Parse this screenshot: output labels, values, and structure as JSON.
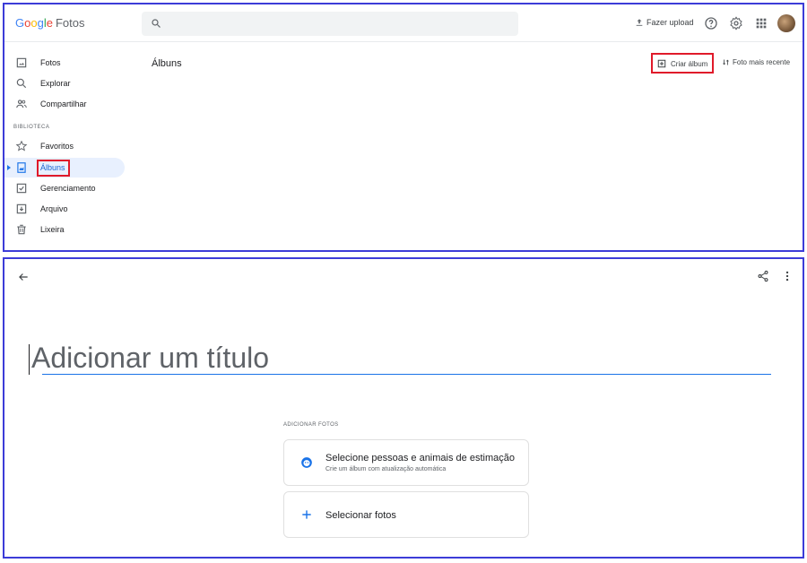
{
  "header": {
    "logo_letters": [
      "G",
      "o",
      "o",
      "g",
      "l",
      "e"
    ],
    "logo_product": "Fotos",
    "search_placeholder": "",
    "upload_label": "Fazer upload"
  },
  "sidebar": {
    "items": [
      {
        "label": "Fotos",
        "icon": "photo-icon"
      },
      {
        "label": "Explorar",
        "icon": "search-icon"
      },
      {
        "label": "Compartilhar",
        "icon": "people-icon"
      }
    ],
    "library_label": "BIBLIOTECA",
    "library_items": [
      {
        "label": "Favoritos",
        "icon": "star-icon"
      },
      {
        "label": "Álbuns",
        "icon": "album-icon",
        "active": true
      },
      {
        "label": "Gerenciamento",
        "icon": "utilities-icon"
      },
      {
        "label": "Arquivo",
        "icon": "archive-icon"
      },
      {
        "label": "Lixeira",
        "icon": "trash-icon"
      }
    ]
  },
  "albums_page": {
    "title": "Álbuns",
    "create_label": "Criar álbum",
    "sort_label": "Foto mais recente"
  },
  "new_album": {
    "title_placeholder": "Adicionar um título",
    "add_photos_label": "ADICIONAR FOTOS",
    "people_option_title": "Selecione pessoas e animais de estimação",
    "people_option_subtitle": "Crie um álbum com atualização automática",
    "photos_option_title": "Selecionar fotos"
  },
  "colors": {
    "accent": "#1a73e8",
    "highlight_box": "#e01a2a",
    "panel_border": "#3c3cd8",
    "active_bg": "#e8f0fe"
  }
}
